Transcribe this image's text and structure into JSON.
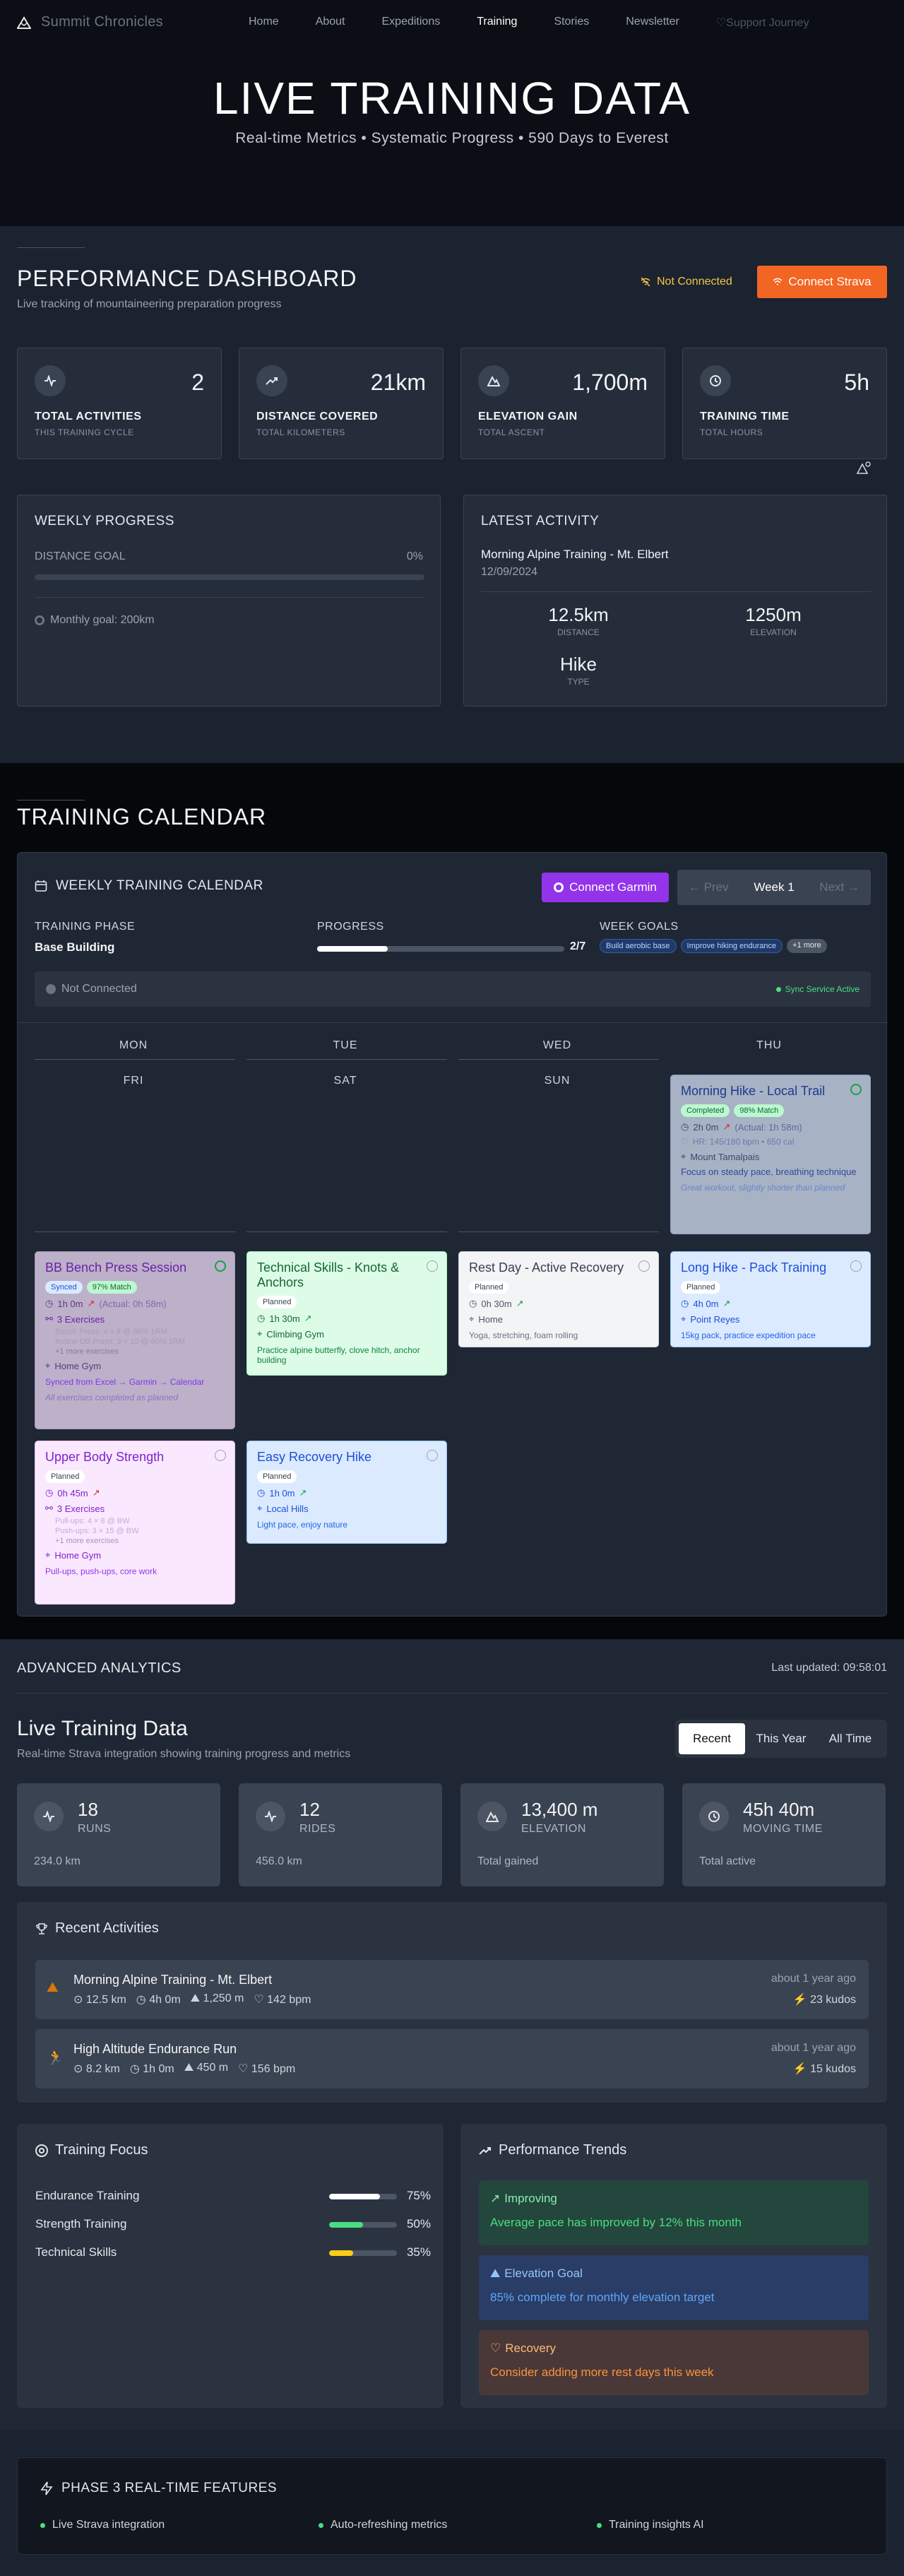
{
  "nav": {
    "brand": "Summit Chronicles",
    "links": [
      "Home",
      "About",
      "Expeditions",
      "Training",
      "Stories",
      "Newsletter"
    ],
    "active": "Training",
    "support": "♡Support Journey"
  },
  "hero": {
    "title": "LIVE TRAINING DATA",
    "subtitle": "Real-time Metrics • Systematic Progress • 590 Days to Everest"
  },
  "dashboard": {
    "title": "PERFORMANCE DASHBOARD",
    "subtitle": "Live tracking of mountaineering preparation progress",
    "status": "Not Connected",
    "connect_label": "Connect Strava",
    "stats": [
      {
        "icon": "activity-icon",
        "value": "2",
        "label": "TOTAL ACTIVITIES",
        "sub": "THIS TRAINING CYCLE"
      },
      {
        "icon": "trending-up-icon",
        "value": "21km",
        "label": "DISTANCE COVERED",
        "sub": "TOTAL KILOMETERS"
      },
      {
        "icon": "mountain-icon",
        "value": "1,700m",
        "label": "ELEVATION GAIN",
        "sub": "TOTAL ASCENT"
      },
      {
        "icon": "clock-icon",
        "value": "5h",
        "label": "TRAINING TIME",
        "sub": "TOTAL HOURS"
      }
    ],
    "weekly": {
      "title": "WEEKLY PROGRESS",
      "goal_label": "DISTANCE GOAL",
      "goal_pct": "0%",
      "goal_fraction": 0,
      "monthly": "Monthly goal: 200km"
    },
    "latest": {
      "title": "LATEST ACTIVITY",
      "name": "Morning Alpine Training - Mt. Elbert",
      "date": "12/09/2024",
      "distance": "12.5km",
      "distance_label": "DISTANCE",
      "elevation": "1250m",
      "elevation_label": "ELEVATION",
      "type": "Hike",
      "type_label": "TYPE"
    }
  },
  "calendar": {
    "section_title": "TRAINING CALENDAR",
    "title": "WEEKLY TRAINING CALENDAR",
    "garmin_label": "Connect Garmin",
    "prev": "← Prev",
    "week": "Week 1",
    "next": "Next →",
    "phase_label": "TRAINING PHASE",
    "phase": "Base Building",
    "progress_label": "PROGRESS",
    "progress": "2/7",
    "progress_fraction": 0.2857,
    "goals_label": "WEEK GOALS",
    "goals": [
      "Build aerobic base",
      "Improve hiking endurance",
      "+1 more"
    ],
    "status": "Not Connected",
    "sync": "Sync Service Active",
    "days_row1": [
      "MON",
      "TUE",
      "WED",
      "THU"
    ],
    "days_row2": [
      "FRI",
      "SAT",
      "SUN"
    ],
    "workouts": {
      "thu": {
        "title": "Morning Hike - Local Trail",
        "badge1": "Completed",
        "badge2": "98% Match",
        "time": "2h 0m",
        "actual": "(Actual: 1h 58m)",
        "hr": "HR: 145/180 bpm • 650 cal",
        "location": "Mount Tamalpais",
        "desc": "Focus on steady pace, breathing technique",
        "note": "Great workout, slightly shorter than planned"
      },
      "mon": {
        "title": "BB Bench Press Session",
        "badge1": "Synced",
        "badge2": "97% Match",
        "time": "1h 0m",
        "actual": "(Actual: 0h 58m)",
        "exercises": "3 Exercises",
        "ex1": "Bench Press: 4 × 8 @ 80% 1RM",
        "ex2": "Incline DB Press: 3 × 10 @ 60% 1RM",
        "more": "+1 more exercises",
        "location": "Home Gym",
        "sync": "Synced from Excel → Garmin → Calendar",
        "note": "All exercises completed as planned"
      },
      "tue": {
        "title": "Technical Skills - Knots & Anchors",
        "badge1": "Planned",
        "time": "1h 30m",
        "location": "Climbing Gym",
        "desc": "Practice alpine butterfly, clove hitch, anchor building"
      },
      "wed": {
        "title": "Rest Day - Active Recovery",
        "badge1": "Planned",
        "time": "0h 30m",
        "location": "Home",
        "desc": "Yoga, stretching, foam rolling"
      },
      "thu2": {
        "title": "Long Hike - Pack Training",
        "badge1": "Planned",
        "time": "4h 0m",
        "location": "Point Reyes",
        "desc": "15kg pack, practice expedition pace"
      },
      "fri": {
        "title": "Upper Body Strength",
        "badge1": "Planned",
        "time": "0h 45m",
        "exercises": "3 Exercises",
        "ex1": "Pull-ups: 4 × 8 @ BW",
        "ex2": "Push-ups: 3 × 15 @ BW",
        "more": "+1 more exercises",
        "location": "Home Gym",
        "desc": "Pull-ups, push-ups, core work"
      },
      "sat": {
        "title": "Easy Recovery Hike",
        "badge1": "Planned",
        "time": "1h 0m",
        "location": "Local Hills",
        "desc": "Light pace, enjoy nature"
      }
    }
  },
  "analytics": {
    "header": "ADVANCED ANALYTICS",
    "updated": "Last updated: 09:58:01",
    "title": "Live Training Data",
    "subtitle": "Real-time Strava integration showing training progress and metrics",
    "tabs": [
      "Recent",
      "This Year",
      "All Time"
    ],
    "tab_active": "Recent",
    "stats": [
      {
        "icon": "activity-icon",
        "value": "18",
        "label": "RUNS",
        "foot": "234.0 km"
      },
      {
        "icon": "activity-icon",
        "value": "12",
        "label": "RIDES",
        "foot": "456.0 km"
      },
      {
        "icon": "mountain-icon",
        "value": "13,400 m",
        "label": "ELEVATION",
        "foot": "Total gained"
      },
      {
        "icon": "clock-icon",
        "value": "45h 40m",
        "label": "MOVING TIME",
        "foot": "Total active"
      }
    ],
    "recent_title": "Recent Activities",
    "activities": [
      {
        "name": "Morning Alpine Training - Mt. Elbert",
        "dist": "12.5 km",
        "time": "4h 0m",
        "elev": "1,250 m",
        "hr": "142 bpm",
        "ago": "about 1 year ago",
        "kudos": "23 kudos"
      },
      {
        "name": "High Altitude Endurance Run",
        "dist": "8.2 km",
        "time": "1h 0m",
        "elev": "450 m",
        "hr": "156 bpm",
        "ago": "about 1 year ago",
        "kudos": "15 kudos"
      }
    ],
    "focus_title": "Training Focus",
    "focus": [
      {
        "label": "Endurance Training",
        "pct": "75%",
        "value": 0.75,
        "color": "#ffffff"
      },
      {
        "label": "Strength Training",
        "pct": "50%",
        "value": 0.5,
        "color": "#4ade80"
      },
      {
        "label": "Technical Skills",
        "pct": "35%",
        "value": 0.35,
        "color": "#facc15"
      }
    ],
    "trends_title": "Performance Trends",
    "trends": [
      {
        "title": "Improving",
        "desc": "Average pace has improved by 12% this month"
      },
      {
        "title": "Elevation Goal",
        "desc": "85% complete for monthly elevation target"
      },
      {
        "title": "Recovery",
        "desc": "Consider adding more rest days this week"
      }
    ]
  },
  "phase3": {
    "title": "PHASE 3 REAL-TIME FEATURES",
    "features": [
      "Live Strava integration",
      "Auto-refreshing metrics",
      "Training insights AI"
    ]
  }
}
